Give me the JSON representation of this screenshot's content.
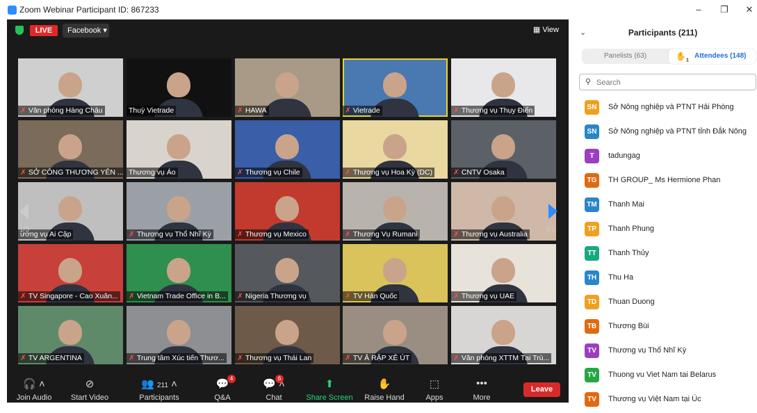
{
  "window": {
    "title": "Zoom Webinar Participant ID: 867233",
    "min": "–",
    "max": "❐",
    "close": "✕"
  },
  "top": {
    "live": "LIVE",
    "facebook": "Facebook ▾",
    "view": "View"
  },
  "pager": {
    "left": "1/3",
    "right": "1/3"
  },
  "tiles": [
    {
      "label": "Văn phòng Hàng Châu",
      "muted": true,
      "bg": "#cfcfcf"
    },
    {
      "label": "Thuỳ Vietrade",
      "muted": false,
      "bg": "#111111"
    },
    {
      "label": "HAWA",
      "muted": true,
      "bg": "#a89a86"
    },
    {
      "label": "Vietrade",
      "muted": true,
      "bg": "#4a78b0"
    },
    {
      "label": "Thương vụ Thụy Điển",
      "muted": true,
      "bg": "#e8e8ea"
    },
    {
      "label": "SỞ CÔNG THƯƠNG YÊN ...",
      "muted": true,
      "bg": "#7a6b5a"
    },
    {
      "label": "Thương vụ Áo",
      "muted": false,
      "bg": "#d8d3cc"
    },
    {
      "label": "Thương vụ Chile",
      "muted": true,
      "bg": "#3a5ea8"
    },
    {
      "label": "Thương vụ Hoa Kỳ (DC)",
      "muted": true,
      "bg": "#e9d8a0"
    },
    {
      "label": "CNTV Osaka",
      "muted": true,
      "bg": "#5c6168"
    },
    {
      "label": "ương vụ Ai Cập",
      "muted": false,
      "bg": "#bfbfbf"
    },
    {
      "label": "Thương vụ Thổ Nhĩ Kỳ",
      "muted": true,
      "bg": "#9aa0a6"
    },
    {
      "label": "Thương vụ Mexico",
      "muted": true,
      "bg": "#c23a2e"
    },
    {
      "label": "Thương Vụ Rumani",
      "muted": true,
      "bg": "#b9b3ad"
    },
    {
      "label": "Thương vụ Australia",
      "muted": true,
      "bg": "#d0b8a8"
    },
    {
      "label": "TV Singapore - Cao Xuân...",
      "muted": true,
      "bg": "#c8403a"
    },
    {
      "label": "Vietnam Trade Office in B...",
      "muted": true,
      "bg": "#2f8f4e"
    },
    {
      "label": "Nigeria Thương vụ",
      "muted": true,
      "bg": "#55595e"
    },
    {
      "label": "TV Hàn Quốc",
      "muted": true,
      "bg": "#d9c35a"
    },
    {
      "label": "Thương vụ UAE",
      "muted": true,
      "bg": "#e7e2da"
    },
    {
      "label": "TV ARGENTINA",
      "muted": true,
      "bg": "#5f8a6a"
    },
    {
      "label": "Trung tâm Xúc tiến Thươ...",
      "muted": true,
      "bg": "#8d8f93"
    },
    {
      "label": "Thương vụ Thái Lan",
      "muted": true,
      "bg": "#6e5a48"
    },
    {
      "label": "TV Ả RẬP XÊ ÚT",
      "muted": true,
      "bg": "#9a8e82"
    },
    {
      "label": "Văn phòng XTTM Tại Trù...",
      "muted": true,
      "bg": "#d8d6d4"
    }
  ],
  "toolbar": {
    "join_audio": "Join Audio",
    "start_video": "Start Video",
    "participants": "Participants",
    "participants_count": "211",
    "qa": "Q&A",
    "qa_badge": "4",
    "chat": "Chat",
    "chat_badge": "6",
    "share_screen": "Share Screen",
    "raise_hand": "Raise Hand",
    "apps": "Apps",
    "more": "More",
    "leave": "Leave"
  },
  "panel": {
    "title": "Participants (211)",
    "tab_panelists": "Panelists (63)",
    "tab_attendees": "Attendees (148)",
    "hand_count": "1",
    "search_placeholder": "Search",
    "attendees": [
      {
        "initials": "SN",
        "name": "Sở Nông nghiệp và PTNT Hải Phòng",
        "color": "#f0a020"
      },
      {
        "initials": "SN",
        "name": "Sở Nông nghiệp và PTNT tỉnh Đắk Nông",
        "color": "#2a86c8"
      },
      {
        "initials": "T",
        "name": "tadungag",
        "color": "#9b3fc0"
      },
      {
        "initials": "TG",
        "name": "TH GROUP_ Ms Hermione Phan",
        "color": "#e06a10"
      },
      {
        "initials": "TM",
        "name": "Thanh Mai",
        "color": "#2a86c8"
      },
      {
        "initials": "TP",
        "name": "Thanh Phung",
        "color": "#f0a020"
      },
      {
        "initials": "TT",
        "name": "Thanh Thủy",
        "color": "#18a880"
      },
      {
        "initials": "TH",
        "name": "Thu Ha",
        "color": "#2a86c8"
      },
      {
        "initials": "TD",
        "name": "Thuan Duong",
        "color": "#f0a020"
      },
      {
        "initials": "TB",
        "name": "Thương Bùi",
        "color": "#e06a10"
      },
      {
        "initials": "TV",
        "name": "Thương vụ Thổ Nhĩ Kỳ",
        "color": "#9b3fc0"
      },
      {
        "initials": "TV",
        "name": "Thuong vu Viet Nam tai Belarus",
        "color": "#25a745"
      },
      {
        "initials": "TV",
        "name": "Thương vụ Việt Nam tại Úc",
        "color": "#e06a10"
      }
    ]
  }
}
